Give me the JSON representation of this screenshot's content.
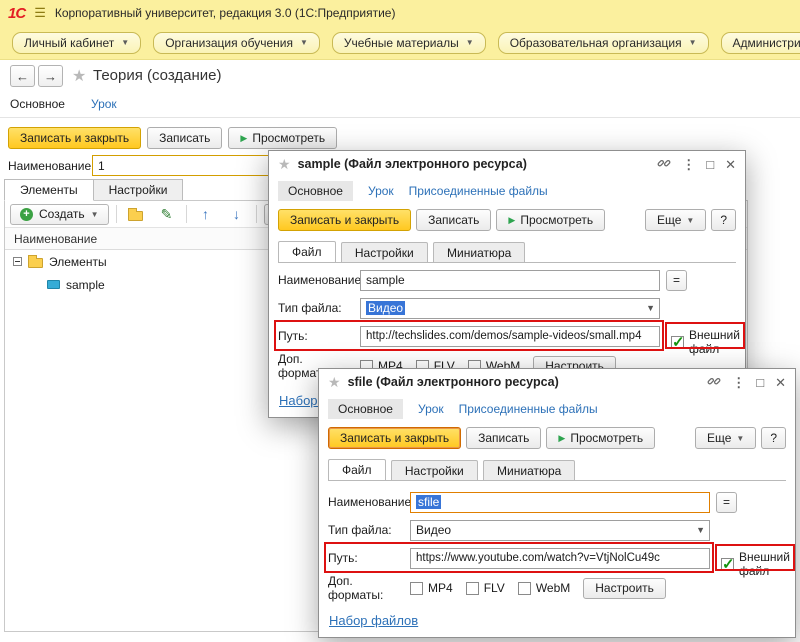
{
  "titlebar": {
    "logo": "1С",
    "title": "Корпоративный университет, редакция 3.0  (1С:Предприятие)"
  },
  "menubar": {
    "items": [
      {
        "label": "Личный кабинет"
      },
      {
        "label": "Организация обучения"
      },
      {
        "label": "Учебные материалы"
      },
      {
        "label": "Образовательная организация"
      },
      {
        "label": "Администрирование"
      }
    ]
  },
  "page": {
    "title": "Теория (создание)",
    "tabs": {
      "main": "Основное",
      "lesson": "Урок"
    },
    "buttons": {
      "save_close": "Записать и закрыть",
      "save": "Записать",
      "preview": "Просмотреть"
    },
    "name": {
      "label": "Наименование:",
      "value": "1"
    },
    "section_tabs": {
      "elements": "Элементы",
      "settings": "Настройки"
    },
    "toolbar": {
      "create": "Создать",
      "add": "Добавить"
    },
    "list": {
      "header": "Наименование",
      "group_row": "Элементы",
      "item_row": "sample"
    }
  },
  "dialog1": {
    "title": "sample (Файл электронного ресурса)",
    "tabs": {
      "main": "Основное",
      "lesson": "Урок",
      "attached": "Присоединенные файлы"
    },
    "buttons": {
      "save_close": "Записать и закрыть",
      "save": "Записать",
      "preview": "Просмотреть",
      "more": "Еще",
      "help": "?"
    },
    "file_tabs": {
      "file": "Файл",
      "settings": "Настройки",
      "thumb": "Миниатюра"
    },
    "fields": {
      "name_label": "Наименование:",
      "name_value": "sample",
      "type_label": "Тип файла:",
      "type_value": "Видео",
      "path_label": "Путь:",
      "path_value": "http://techslides.com/demos/sample-videos/small.mp4",
      "external_file": "Внешний файл",
      "formats_label": "Доп. форматы:",
      "format_mp4": "MP4",
      "format_flv": "FLV",
      "format_webm": "WebM",
      "configure": "Настроить",
      "equals": "="
    },
    "files_link": "Набор файлов"
  },
  "dialog2": {
    "title": "sfile (Файл электронного ресурса)",
    "tabs": {
      "main": "Основное",
      "lesson": "Урок",
      "attached": "Присоединенные файлы"
    },
    "buttons": {
      "save_close": "Записать и закрыть",
      "save": "Записать",
      "preview": "Просмотреть",
      "more": "Еще",
      "help": "?"
    },
    "file_tabs": {
      "file": "Файл",
      "settings": "Настройки",
      "thumb": "Миниатюра"
    },
    "fields": {
      "name_label": "Наименование:",
      "name_value": "sfile",
      "type_label": "Тип файла:",
      "type_value": "Видео",
      "path_label": "Путь:",
      "path_value": "https://www.youtube.com/watch?v=VtjNolCu49c",
      "external_file": "Внешний файл",
      "formats_label": "Доп. форматы:",
      "format_mp4": "MP4",
      "format_flv": "FLV",
      "format_webm": "WebM",
      "configure": "Настроить",
      "equals": "="
    },
    "files_link": "Набор файлов"
  }
}
